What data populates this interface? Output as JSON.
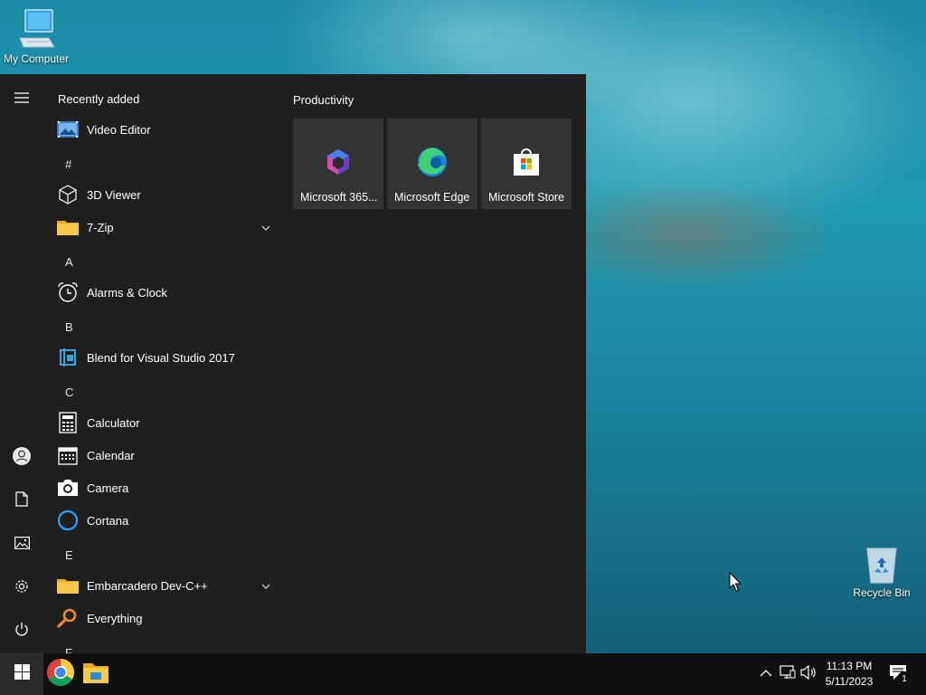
{
  "desktop": {
    "icons": [
      {
        "label": "My Computer",
        "icon": "computer-icon"
      },
      {
        "label": "Recycle Bin",
        "icon": "recycle-bin-icon"
      }
    ]
  },
  "start_menu": {
    "rail": [
      "hamburger-icon",
      "user-icon",
      "documents-icon",
      "pictures-icon",
      "settings-icon",
      "power-icon"
    ],
    "recently_added_label": "Recently added",
    "apps": {
      "video_editor": "Video Editor",
      "3d_viewer": "3D Viewer",
      "7zip": "7-Zip",
      "alarms": "Alarms & Clock",
      "blend": "Blend for Visual Studio 2017",
      "calculator": "Calculator",
      "calendar": "Calendar",
      "camera": "Camera",
      "cortana": "Cortana",
      "devcpp": "Embarcadero Dev-C++",
      "everything": "Everything"
    },
    "letters": {
      "hash": "#",
      "a": "A",
      "b": "B",
      "c": "C",
      "e": "E",
      "f": "F"
    },
    "tiles": {
      "group_title": "Productivity",
      "items": [
        {
          "label": "Microsoft 365...",
          "icon": "microsoft-365-icon"
        },
        {
          "label": "Microsoft Edge",
          "icon": "edge-icon"
        },
        {
          "label": "Microsoft Store",
          "icon": "store-icon"
        }
      ]
    }
  },
  "taskbar": {
    "pinned": [
      "chrome-icon",
      "file-explorer-icon"
    ],
    "tray": [
      "chevron-up-icon",
      "network-icon",
      "volume-icon"
    ],
    "time": "11:13 PM",
    "date": "5/11/2023",
    "notification_count": "1"
  },
  "colors": {
    "menu_bg": "#1f1f1f",
    "tile_bg": "#333333",
    "taskbar_bg": "#101010"
  }
}
